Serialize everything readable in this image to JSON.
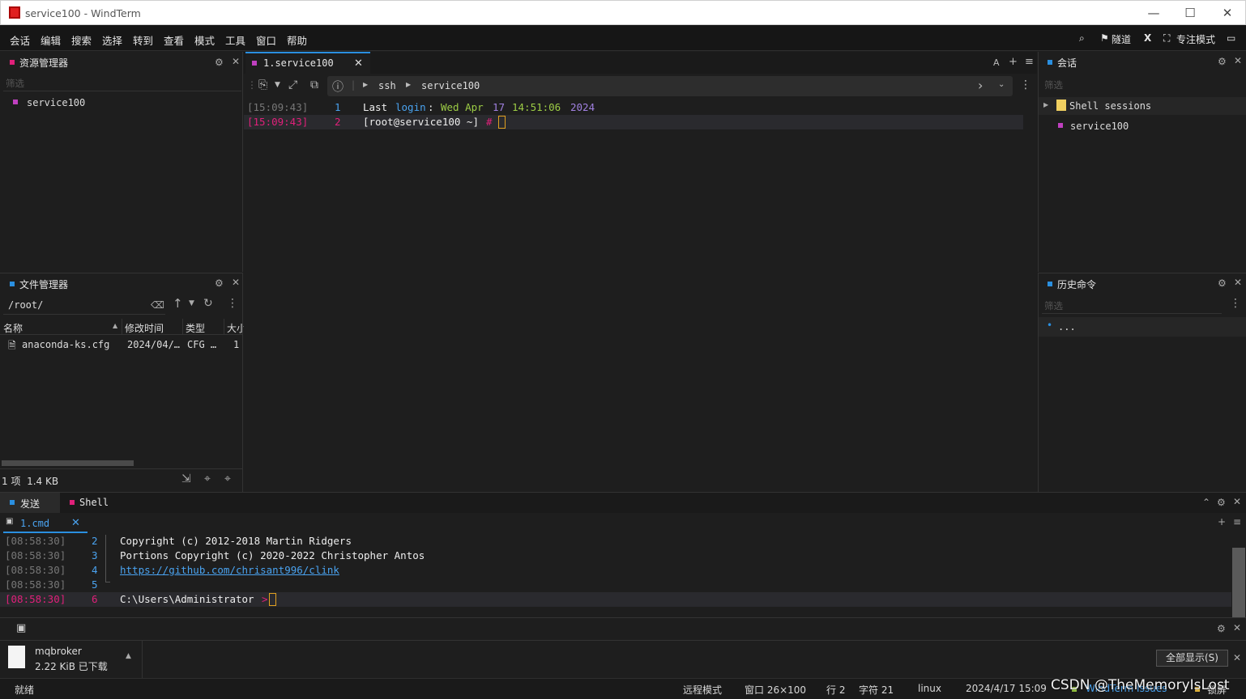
{
  "window": {
    "title": "service100 - WindTerm",
    "minimize": "—",
    "maximize": "☐",
    "close": "✕"
  },
  "menu": {
    "items": [
      "会话",
      "编辑",
      "搜索",
      "选择",
      "转到",
      "查看",
      "模式",
      "工具",
      "窗口",
      "帮助"
    ],
    "right": {
      "tunnel": "隧道",
      "x": "X",
      "focus": "专注模式"
    }
  },
  "explorer": {
    "title": "资源管理器",
    "filter": "筛选",
    "items": [
      "service100"
    ]
  },
  "files": {
    "title": "文件管理器",
    "path": "/root/",
    "columns": [
      "名称",
      "修改时间",
      "类型",
      "大小"
    ],
    "rows": [
      {
        "name": "anaconda-ks.cfg",
        "mtime": "2024/04/…",
        "type": "CFG …",
        "size": "1"
      }
    ],
    "status": "1 项  1.4 KB"
  },
  "terminal": {
    "tab": "1.service100",
    "crumb": [
      "ssh",
      "service100"
    ],
    "lines": [
      {
        "time": "[15:09:43]",
        "num": "1",
        "seg": [
          "Last ",
          "login",
          ": ",
          "Wed Apr ",
          "17 ",
          "14:51:06 ",
          "2024"
        ]
      },
      {
        "time": "[15:09:43]",
        "num": "2",
        "text": "[root@service100 ~]",
        "prompt": "#"
      }
    ]
  },
  "sessions": {
    "title": "会话",
    "filter": "筛选",
    "group": "Shell sessions",
    "items": [
      "service100"
    ]
  },
  "history": {
    "title": "历史命令",
    "filter": "筛选",
    "items": [
      "..."
    ]
  },
  "bottom": {
    "tabs": [
      "发送",
      "Shell"
    ],
    "subtab": "1.cmd",
    "lines": [
      {
        "time": "[08:58:30]",
        "num": "2",
        "text": "Copyright (c) 2012-2018 Martin Ridgers"
      },
      {
        "time": "[08:58:30]",
        "num": "3",
        "text": "Portions Copyright (c) 2020-2022 Christopher Antos"
      },
      {
        "time": "[08:58:30]",
        "num": "4",
        "text": "https://github.com/chrisant996/clink"
      },
      {
        "time": "[08:58:30]",
        "num": "5",
        "text": ""
      },
      {
        "time": "[08:58:30]",
        "num": "6",
        "text": "C:\\Users\\Administrator",
        "prompt": ">"
      }
    ]
  },
  "download": {
    "name": "mqbroker",
    "info": "2.22 KiB 已下载",
    "show_all": "全部显示(S)"
  },
  "status": {
    "ready": "就绪",
    "remote": "远程模式",
    "window": "窗口 26×100",
    "row": "行 2",
    "col": "字符 21",
    "os": "linux",
    "datetime": "2024/4/17 15:09",
    "issues": "WindTerm Issues",
    "lock": "锁屏",
    "watermark": "CSDN @TheMemoryIsLost"
  },
  "colors": {
    "accent": "#2a8fe0",
    "magenta": "#c040c0",
    "pink": "#e0207a",
    "blue": "#4aa3f0",
    "green": "#9ccc45",
    "purple": "#a080e0"
  }
}
